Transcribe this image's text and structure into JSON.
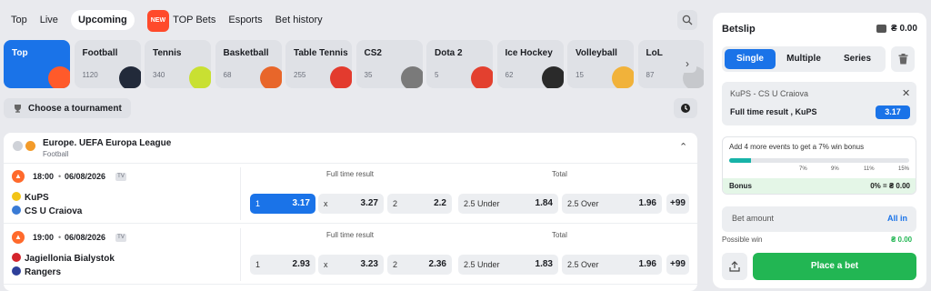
{
  "nav": {
    "top": "Top",
    "live": "Live",
    "upcoming": "Upcoming",
    "new_badge": "NEW",
    "top_bets": "TOP Bets",
    "esports": "Esports",
    "bet_history": "Bet history"
  },
  "categories": [
    {
      "name": "Top",
      "count": "",
      "color": "#ff5a2a"
    },
    {
      "name": "Football",
      "count": "1120",
      "color": "#222a3a"
    },
    {
      "name": "Tennis",
      "count": "340",
      "color": "#c9e032"
    },
    {
      "name": "Basketball",
      "count": "68",
      "color": "#e8662a"
    },
    {
      "name": "Table Tennis",
      "count": "255",
      "color": "#e33b2e"
    },
    {
      "name": "CS2",
      "count": "35",
      "color": "#7a7a7a"
    },
    {
      "name": "Dota 2",
      "count": "5",
      "color": "#e3402f"
    },
    {
      "name": "Ice Hockey",
      "count": "62",
      "color": "#2a2a2a"
    },
    {
      "name": "Volleyball",
      "count": "15",
      "color": "#f1b23a"
    },
    {
      "name": "LoL",
      "count": "87",
      "color": "#c6c8cc"
    }
  ],
  "tournament_button": "Choose a tournament",
  "league": {
    "name": "Europe. UEFA Europa League",
    "sport": "Football"
  },
  "columns": {
    "full_time": "Full time result",
    "total": "Total"
  },
  "events": [
    {
      "time": "18:00",
      "date": "06/08/2026",
      "home": "KuPS",
      "away": "CS U Craiova",
      "home_color": "#f2c417",
      "away_color": "#3a7bd5",
      "odds": [
        {
          "label": "1",
          "value": "3.17"
        },
        {
          "label": "x",
          "value": "3.27"
        },
        {
          "label": "2",
          "value": "2.2"
        }
      ],
      "totals": [
        {
          "label": "2.5 Under",
          "value": "1.84"
        },
        {
          "label": "2.5 Over",
          "value": "1.96"
        }
      ],
      "more": "+99"
    },
    {
      "time": "19:00",
      "date": "06/08/2026",
      "home": "Jagiellonia Bialystok",
      "away": "Rangers",
      "home_color": "#d4242c",
      "away_color": "#2e3f9a",
      "odds": [
        {
          "label": "1",
          "value": "2.93"
        },
        {
          "label": "x",
          "value": "3.23"
        },
        {
          "label": "2",
          "value": "2.36"
        }
      ],
      "totals": [
        {
          "label": "2.5 Under",
          "value": "1.83"
        },
        {
          "label": "2.5 Over",
          "value": "1.96"
        }
      ],
      "more": "+99"
    }
  ],
  "betslip": {
    "title": "Betslip",
    "balance": "₴ 0.00",
    "tabs": [
      "Single",
      "Multiple",
      "Series"
    ],
    "selection": {
      "match": "KuPS - CS U Craiova",
      "market": "Full time result , KuPS",
      "odd": "3.17"
    },
    "bonus": {
      "message": "Add 4 more events to get a 7% win bonus",
      "ticks": [
        "7%",
        "9%",
        "11%",
        "15%"
      ],
      "progress": 0.12,
      "label": "Bonus",
      "value": "0% = ₴ 0.00"
    },
    "amount_placeholder": "Bet amount",
    "all_in": "All in",
    "possible_win_label": "Possible win",
    "possible_win_value": "₴ 0.00",
    "place_button": "Place a bet"
  },
  "colors": {
    "accent": "#1a73e8",
    "green": "#22b653",
    "new": "#ff4a2b"
  }
}
